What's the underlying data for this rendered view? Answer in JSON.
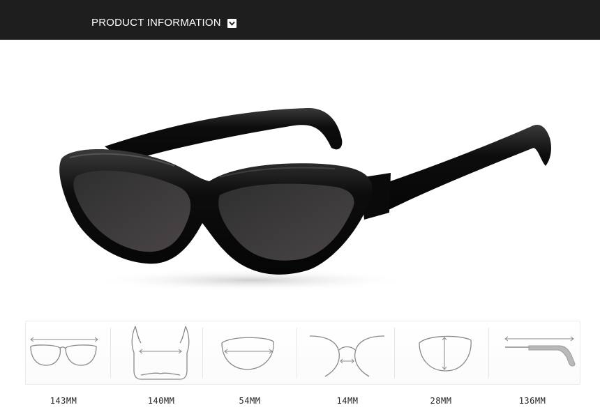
{
  "header": {
    "title": "PRODUCT INFORMATION",
    "icon": "chevron-down-icon"
  },
  "product": {
    "image": "black-cat-eye-sunglasses",
    "frame_color": "#0d0d0d",
    "lens_color": "#3b3b3b"
  },
  "dimensions": [
    {
      "icon": "total-width-icon",
      "value": "143MM"
    },
    {
      "icon": "temple-span-icon",
      "value": "140MM"
    },
    {
      "icon": "lens-width-icon",
      "value": "54MM"
    },
    {
      "icon": "bridge-width-icon",
      "value": "14MM"
    },
    {
      "icon": "lens-height-icon",
      "value": "28MM"
    },
    {
      "icon": "temple-length-icon",
      "value": "136MM"
    }
  ]
}
